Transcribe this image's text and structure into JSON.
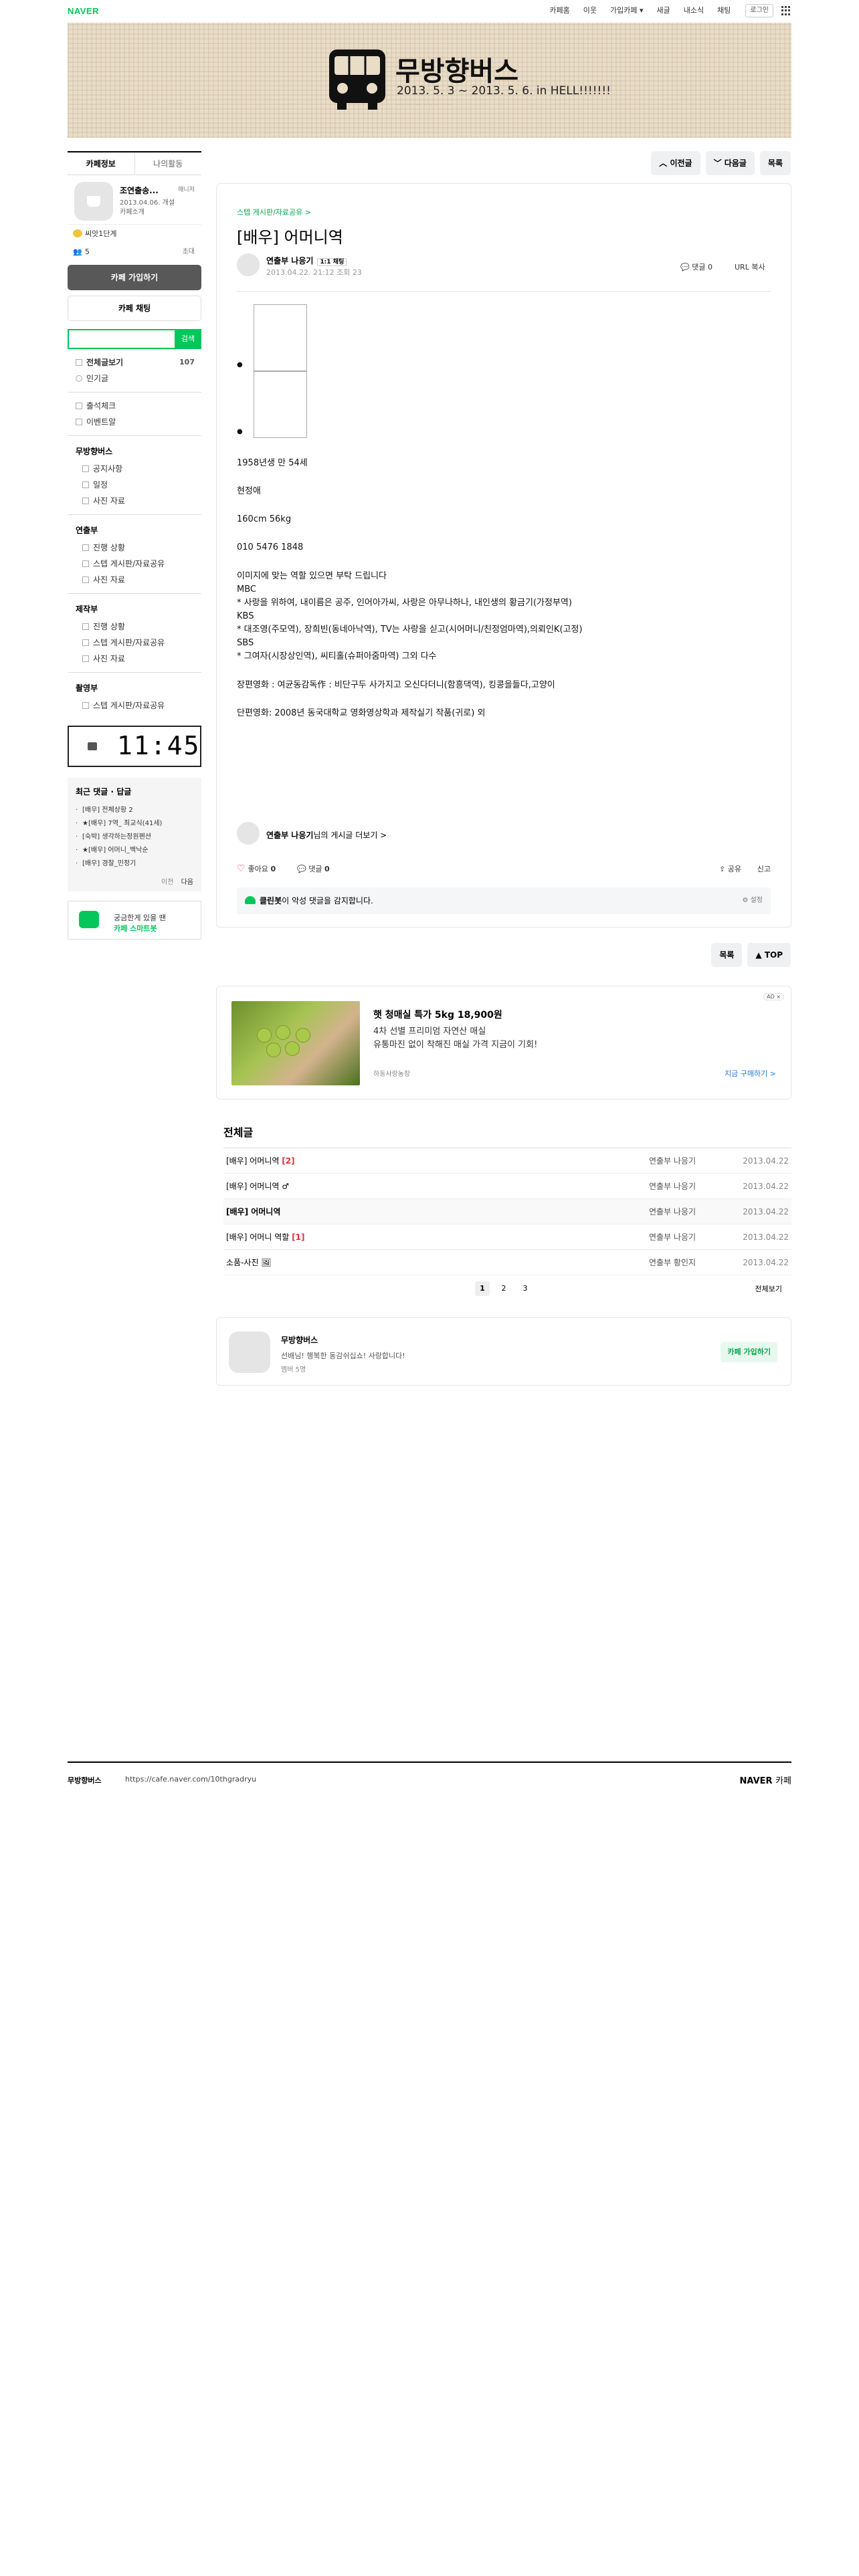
{
  "gnb": {
    "logo": "NAVER",
    "links": [
      "카페홈",
      "이웃",
      "가입카페 ▾",
      "새글",
      "내소식",
      "채팅"
    ],
    "login": "로그인"
  },
  "banner": {
    "title": "무방향버스",
    "subtitle": "2013. 5. 3 ~ 2013. 5. 6. in HELL!!!!!!!",
    "subline": "·· ·· ···· ···· ·· ·· ·· ·· ····"
  },
  "sidebar": {
    "tabs": [
      "카페정보",
      "나의활동"
    ],
    "cafe_name": "조연출송...",
    "manager": "매니저",
    "date": "2013.04.06. 개설",
    "intro": "카페소개",
    "level": "씨앗1단계",
    "members": "5",
    "invite": "초대",
    "join_button": "카페 가입하기",
    "chat_button": "카페 채팅",
    "search_button": "검색",
    "all_posts": "전체글보기",
    "all_count": "107",
    "popular": "인기글",
    "checkin": "출석체크",
    "pick": "이벤트알",
    "group1": "무방향버스",
    "group1_items": [
      "공지사항",
      "일정",
      "사진 자료"
    ],
    "group2": "연출부",
    "group2_items": [
      "진행 상황",
      "스텝 게시판/자료공유",
      "사진 자료"
    ],
    "group3": "제작부",
    "group3_items": [
      "진행 상황",
      "스텝 게시판/자료공유",
      "사진 자료"
    ],
    "group4": "촬영부",
    "group4_items": [
      "스텝 게시판/자료공유"
    ],
    "clock": "11:45",
    "recent_title": "최근 댓글 · 답글",
    "recent_items": [
      "[배우] 전체상황 2",
      "★[배우] 7역_ 최교식(41세)",
      "[숙박] 생각하는정원펜션",
      "★[배우] 어머니_백낙순",
      "[배우] 경찰_민정기"
    ],
    "recent_prev": "이전",
    "recent_next": "다음",
    "smart1": "궁금한게 있을 땐",
    "smart2": "카페 스마트봇"
  },
  "topnav": {
    "prev": "이전글",
    "next": "다음글",
    "list": "목록"
  },
  "article": {
    "category": "스텝 게시판/자료공유 >",
    "title": "[배우] 어머니역",
    "author": "연출부 나응기",
    "chat": "1:1 채팅",
    "date": "2013.04.22. 21:12",
    "views": "조회 23",
    "comments": "댓글 0",
    "url_copy": "URL 복사",
    "body": [
      "1958년생 만 54세",
      "",
      "현정애",
      "",
      "160cm 56kg",
      "",
      "010 5476 1848",
      "",
      "이미지에 맞는 역할 있으면 부탁 드립니다",
      "MBC",
      "* 사랑을 위하여, 내이름은 공주, 인어아가씨, 사랑은 아무나하나, 내인생의 황금기(가정부역)",
      "KBS",
      "* 대조영(주모역), 장희빈(동네아낙역), TV는 사랑을 싣고(시어머니/친정엄마역),의뢰인K(고정)",
      "SBS",
      "* 그여자(시장상인역), 씨티홀(슈퍼아줌마역) 그외 다수",
      "",
      "장편영화 : 여균동감독作 : 비단구두 사가지고 오신다더니(함흥댁역), 킹콩을들다,고양이",
      "",
      "단편영화: 2008년 동국대학교 영화영상학과 제작실기 작품(귀로) 외"
    ],
    "foot_author": "연출부 나응기",
    "foot_more": "님의 게시글 더보기 >",
    "like": "좋아요",
    "like_count": "0",
    "comment": "댓글",
    "comment_count": "0",
    "share": "공유",
    "report": "신고",
    "clean_bot": "클린봇",
    "clean_text": "이 악성 댓글을 감지합니다.",
    "clean_set": "설정"
  },
  "bottomnav": {
    "list": "목록",
    "top": "▲ TOP"
  },
  "ad": {
    "badge": "AD ×",
    "title": "햇 청매실 특가 5kg 18,900원",
    "line1": "4차 선별 프리미엄 자연산 매실",
    "line2": "유통마진 없이 착해진 매실 가격 지금이 기회!",
    "source": "하동사랑농장",
    "buy": "지금 구매하기 >"
  },
  "postlist": {
    "title": "전체글",
    "rows": [
      {
        "title": "[배우] 어머니역",
        "reply": "[2]",
        "author": "연출부 나응기",
        "date": "2013.04.22",
        "current": false
      },
      {
        "title": "[배우] 어머니역 ♂",
        "reply": "",
        "author": "연출부 나응기",
        "date": "2013.04.22",
        "current": false
      },
      {
        "title": "[배우] 어머니역",
        "reply": "",
        "author": "연출부 나응기",
        "date": "2013.04.22",
        "current": true
      },
      {
        "title": "[배우] 어머니 역할",
        "reply": "[1]",
        "author": "연출부 나응기",
        "date": "2013.04.22",
        "current": false
      },
      {
        "title": "소품-사진 🖼",
        "reply": "",
        "author": "연출부 황인지",
        "date": "2013.04.22",
        "current": false
      }
    ],
    "pages": [
      "1",
      "2",
      "3"
    ],
    "view_all": "전체보기"
  },
  "cafe_card": {
    "name": "무방향버스",
    "welcome": "선배님! 행복한 동감쉬십쇼! 사랑합니다!",
    "members": "멤버 5명",
    "join": "카페 가입하기"
  },
  "footer": {
    "name": "무방향버스",
    "url": "https://cafe.naver.com/10thgradryu",
    "brand": "NAVER",
    "brand2": "카페"
  }
}
